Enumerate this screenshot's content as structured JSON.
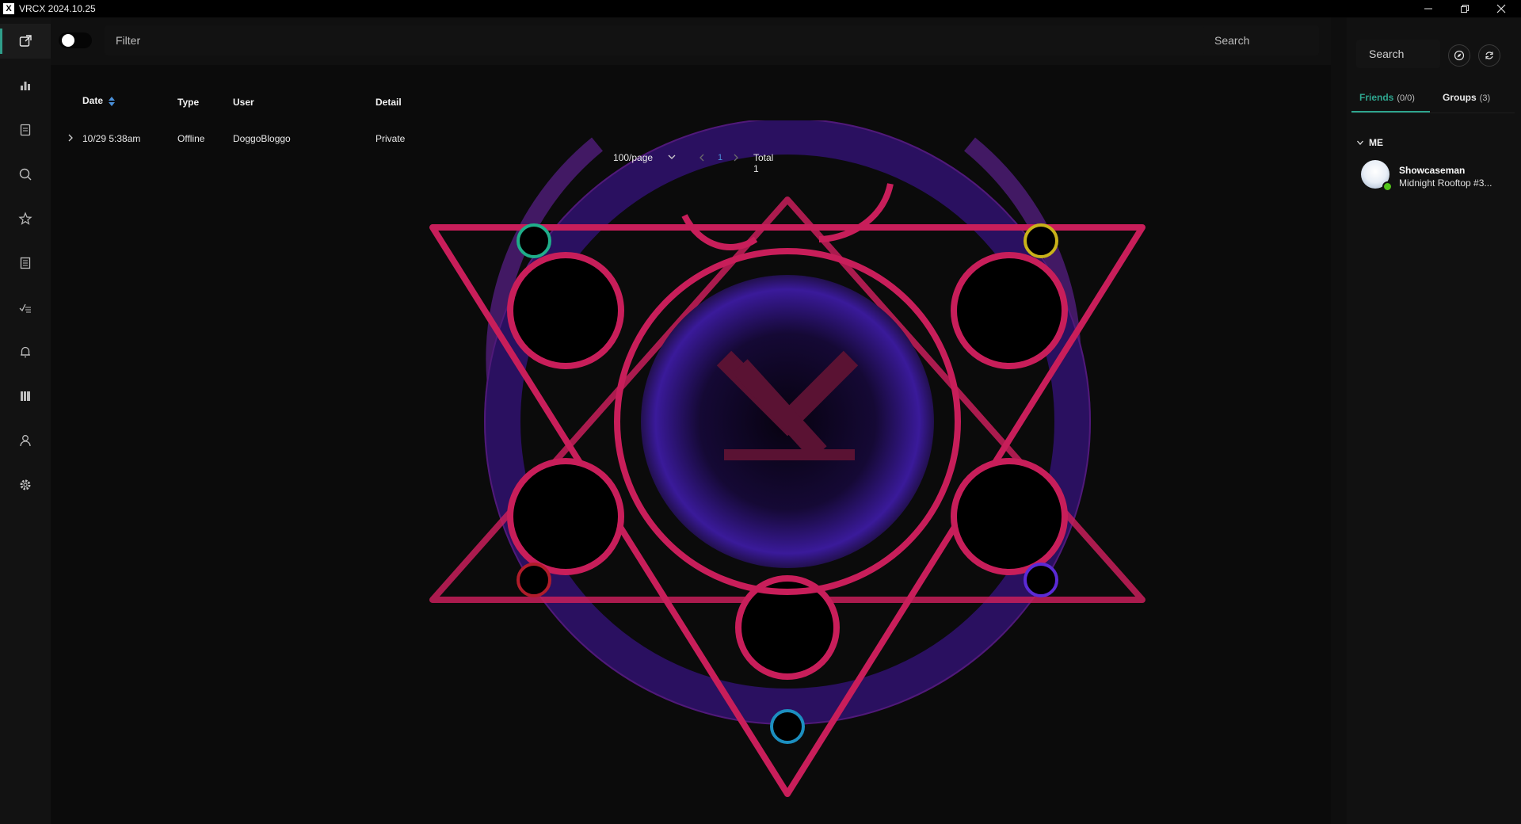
{
  "titlebar": {
    "logo_text": "X",
    "title": "VRCX 2024.10.25",
    "controls": [
      "minimize-icon",
      "restore-icon",
      "close-icon"
    ]
  },
  "nav": {
    "items": [
      {
        "icon": "feed-icon",
        "active": true
      },
      {
        "icon": "chart-icon"
      },
      {
        "icon": "document-icon"
      },
      {
        "icon": "search-icon"
      },
      {
        "icon": "star-icon"
      },
      {
        "icon": "list-icon"
      },
      {
        "icon": "moderation-icon"
      },
      {
        "icon": "bell-icon"
      },
      {
        "icon": "library-icon"
      },
      {
        "icon": "user-icon"
      },
      {
        "icon": "gear-icon"
      }
    ],
    "accent_color": "#2f9e8a"
  },
  "toolbar": {
    "toggle_on": true,
    "filter_placeholder": "Filter",
    "search_placeholder": "Search"
  },
  "table": {
    "headers": {
      "date": "Date",
      "type": "Type",
      "user": "User",
      "detail": "Detail"
    },
    "rows": [
      {
        "date": "10/29 5:38am",
        "type": "Offline",
        "user": "DoggoBloggo",
        "detail": "Private"
      }
    ]
  },
  "pagination": {
    "page_size": "100/page",
    "current_page": "1",
    "total": "Total 1"
  },
  "friends_panel": {
    "search_placeholder": "Search",
    "tabs": {
      "friends_label": "Friends",
      "friends_count": "(0/0)",
      "groups_label": "Groups",
      "groups_count": "(3)"
    },
    "section_me": "ME",
    "me": {
      "name": "Showcaseman",
      "location": "Midnight Rooftop #3...",
      "status_color": "#52c41a"
    }
  },
  "colors": {
    "emblem_primary": "#c81e5a",
    "emblem_secondary": "#3a1a9a",
    "gem_green": "#1fae8a",
    "gem_yellow": "#c9b21a",
    "gem_red": "#b01c2a",
    "gem_violet": "#5b2ad6",
    "gem_cyan": "#1c8fc0"
  }
}
